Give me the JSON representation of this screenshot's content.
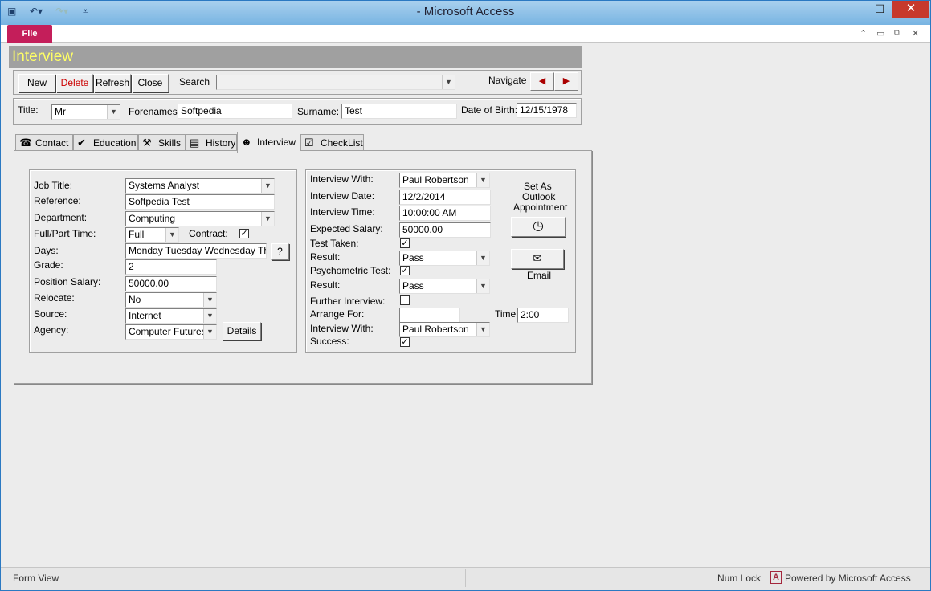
{
  "window": {
    "title": "- Microsoft Access"
  },
  "ribbon": {
    "file_label": "File"
  },
  "form": {
    "header": "Interview",
    "toolbar": {
      "new": "New",
      "delete": "Delete",
      "refresh": "Refresh",
      "close": "Close",
      "search_label": "Search",
      "search_value": "",
      "navigate_label": "Navigate"
    },
    "person": {
      "title_label": "Title:",
      "title_value": "Mr",
      "forenames_label": "Forenames:",
      "forenames_value": "Softpedia",
      "surname_label": "Surname:",
      "surname_value": "Test",
      "dob_label": "Date of Birth:",
      "dob_value": "12/15/1978"
    },
    "tabs": [
      {
        "label": "Contact",
        "icon": "telephone-icon"
      },
      {
        "label": "Education",
        "icon": "abc-check-icon"
      },
      {
        "label": "Skills",
        "icon": "hammer-icon"
      },
      {
        "label": "History",
        "icon": "book-icon"
      },
      {
        "label": "Interview",
        "icon": "cat-face-icon"
      },
      {
        "label": "CheckList",
        "icon": "checklist-icon"
      }
    ],
    "job": {
      "job_title_label": "Job Title:",
      "job_title_value": "Systems Analyst",
      "reference_label": "Reference:",
      "reference_value": "Softpedia Test",
      "department_label": "Department:",
      "department_value": "Computing",
      "fulltime_label": "Full/Part Time:",
      "fulltime_value": "Full",
      "contract_label": "Contract:",
      "contract_checked": true,
      "days_label": "Days:",
      "days_value": "Monday Tuesday Wednesday Thurs",
      "days_help": "?",
      "grade_label": "Grade:",
      "grade_value": "2",
      "salary_label": "Position Salary:",
      "salary_value": "50000.00",
      "relocate_label": "Relocate:",
      "relocate_value": "No",
      "source_label": "Source:",
      "source_value": "Internet",
      "agency_label": "Agency:",
      "agency_value": "Computer Futures",
      "details_button": "Details"
    },
    "interview": {
      "with_label": "Interview With:",
      "with_value": "Paul Robertson",
      "date_label": "Interview Date:",
      "date_value": "12/2/2014",
      "time_label": "Interview Time:",
      "time_value": "10:00:00 AM",
      "expected_label": "Expected Salary:",
      "expected_value": "50000.00",
      "test_taken_label": "Test Taken:",
      "test_taken_checked": true,
      "result_label": "Result:",
      "result_value": "Pass",
      "psych_label": "Psychometric Test:",
      "psych_checked": true,
      "result2_label": "Result:",
      "result2_value": "Pass",
      "further_label": "Further Interview:",
      "further_checked": false,
      "arrange_label": "Arrange For:",
      "arrange_value": "",
      "time2_label": "Time:",
      "time2_value": "2:00",
      "with2_label": "Interview With:",
      "with2_value": "Paul Robertson",
      "success_label": "Success:",
      "success_checked": true,
      "outlook_label_1": "Set As",
      "outlook_label_2": "Outlook",
      "outlook_label_3": "Appointment",
      "email_label": "Email"
    }
  },
  "status": {
    "left": "Form View",
    "numlock": "Num Lock",
    "powered": "Powered by Microsoft Access"
  }
}
